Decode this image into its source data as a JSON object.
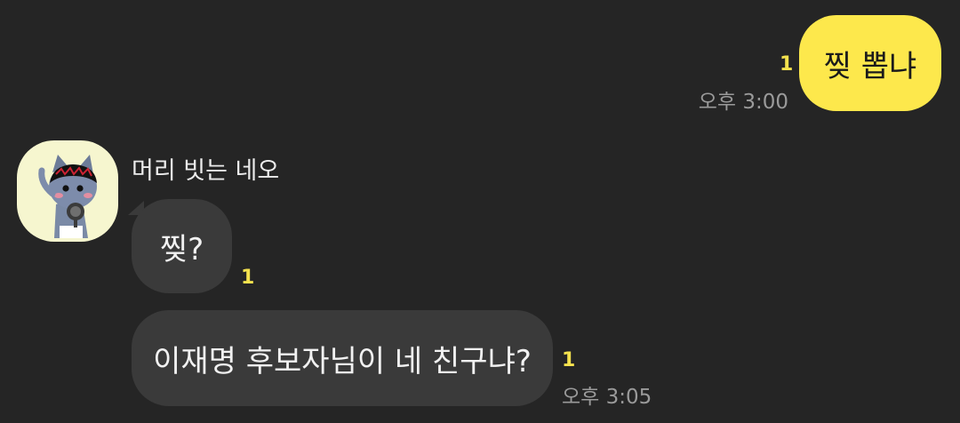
{
  "messages": [
    {
      "direction": "out",
      "text": "찢 뽑냐",
      "unread": "1",
      "time": "오후 3:00"
    },
    {
      "direction": "in",
      "sender": "머리 빗는 네오",
      "text": "찢?",
      "unread": "1"
    },
    {
      "direction": "in",
      "text": "이재명 후보자님이 네 친구냐?",
      "unread": "1",
      "time": "오후 3:05"
    }
  ],
  "colors": {
    "background": "#252525",
    "outgoing_bubble": "#fde84c",
    "incoming_bubble": "#3a3a3a",
    "unread": "#f5e24e",
    "time_text": "#9a9a9a",
    "avatar_bg": "#f6f6cf"
  },
  "icons": {
    "avatar": "neo-character-avatar"
  }
}
